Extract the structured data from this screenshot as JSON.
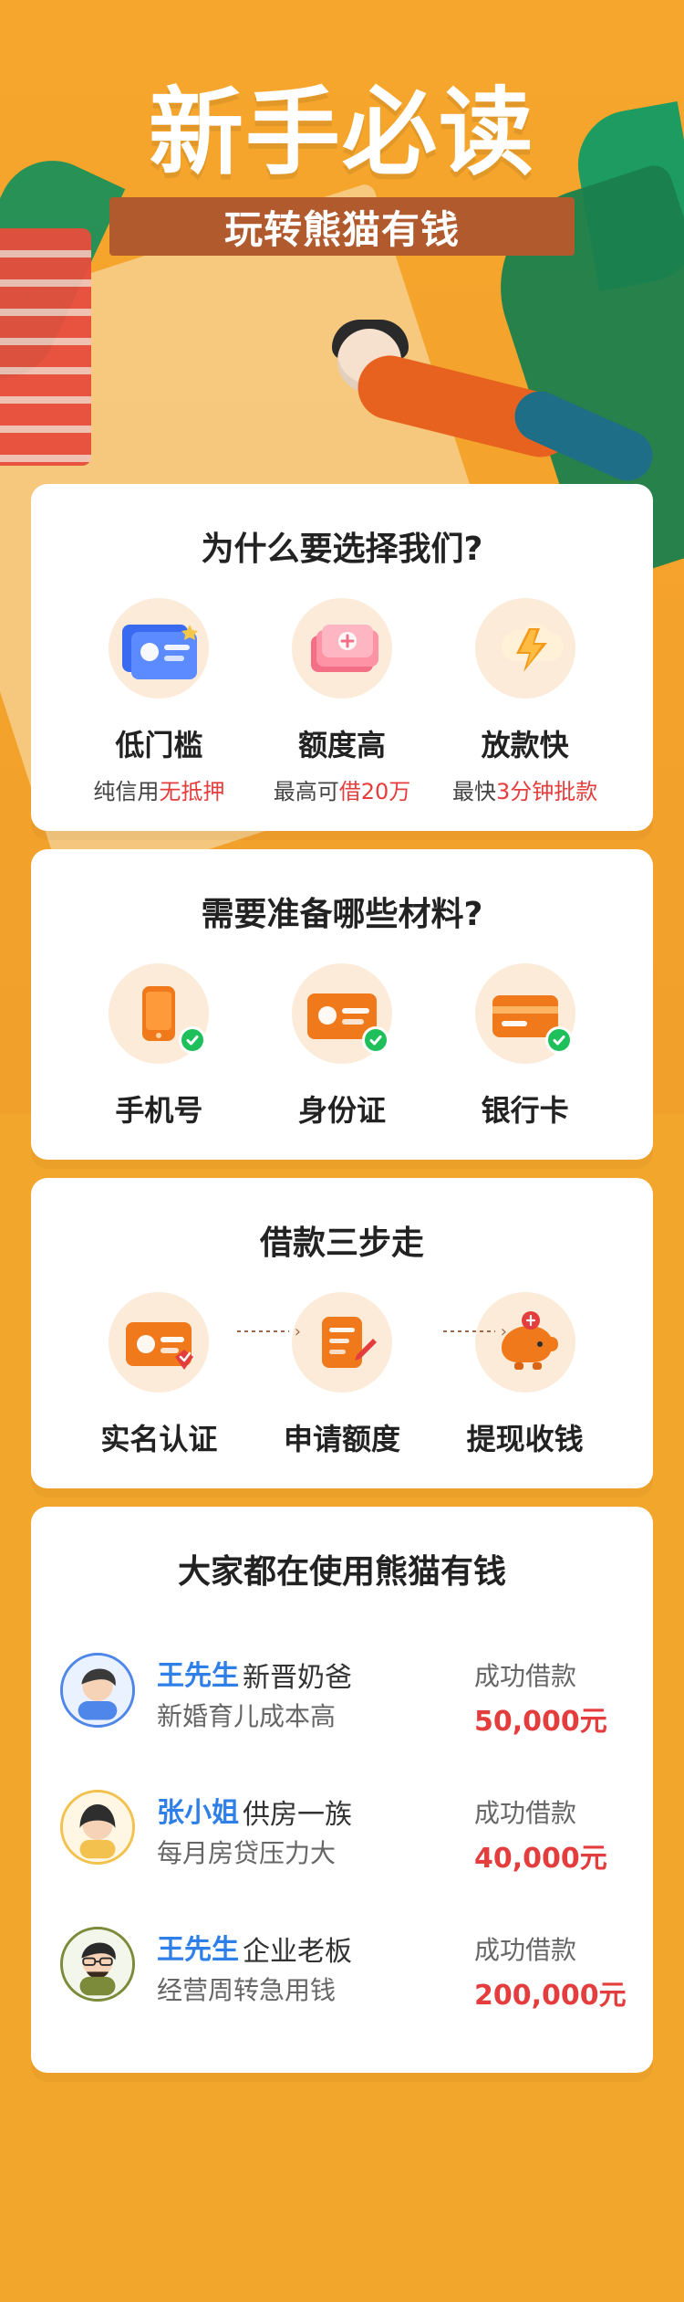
{
  "header": {
    "title": "新手必读",
    "subtitle": "玩转熊猫有钱"
  },
  "why_us": {
    "title": "为什么要选择我们?",
    "items": [
      {
        "label": "低门槛",
        "desc_prefix": "纯信用",
        "desc_highlight": "无抵押",
        "icon": "id-card-icon"
      },
      {
        "label": "额度高",
        "desc_prefix": "最高可",
        "desc_highlight": "借20万",
        "icon": "money-stack-icon"
      },
      {
        "label": "放款快",
        "desc_prefix": "最快",
        "desc_highlight": "3分钟批款",
        "icon": "lightning-icon"
      }
    ]
  },
  "materials": {
    "title": "需要准备哪些材料?",
    "items": [
      {
        "label": "手机号",
        "icon": "phone-icon"
      },
      {
        "label": "身份证",
        "icon": "id-card-icon"
      },
      {
        "label": "银行卡",
        "icon": "bank-card-icon"
      }
    ]
  },
  "steps": {
    "title": "借款三步走",
    "items": [
      {
        "label": "实名认证",
        "icon": "verified-id-icon"
      },
      {
        "label": "申请额度",
        "icon": "edit-document-icon"
      },
      {
        "label": "提现收钱",
        "icon": "piggy-bank-icon"
      }
    ]
  },
  "users_section": {
    "title": "大家都在使用熊猫有钱",
    "loan_label": "成功借款",
    "users": [
      {
        "name": "王先生",
        "tag": "新晋奶爸",
        "note": "新婚育儿成本高",
        "amount": "50,000元"
      },
      {
        "name": "张小姐",
        "tag": "供房一族",
        "note": "每月房贷压力大",
        "amount": "40,000元"
      },
      {
        "name": "王先生",
        "tag": "企业老板",
        "note": "经营周转急用钱",
        "amount": "200,000元"
      }
    ]
  },
  "colors": {
    "page_bg": "#F3A62C",
    "accent_red": "#E43D3D",
    "link_blue": "#2F7FE8"
  }
}
